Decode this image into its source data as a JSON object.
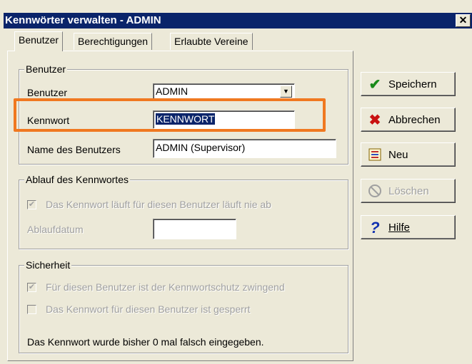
{
  "window": {
    "title": "Kennwörter verwalten - ADMIN",
    "close_label": "x"
  },
  "tabs": [
    {
      "label": "Benutzer"
    },
    {
      "label": "Berechtigungen"
    },
    {
      "label": "Erlaubte Vereine"
    }
  ],
  "group_user": {
    "title": "Benutzer",
    "user_label": "Benutzer",
    "user_value": "ADMIN",
    "password_label": "Kennwort",
    "password_value": "KENNWORT",
    "name_label": "Name des Benutzers",
    "name_value": "ADMIN (Supervisor)"
  },
  "group_expiry": {
    "title": "Ablauf des Kennwortes",
    "never_expires_label": "Das Kennwort läuft für diesen Benutzer läuft nie ab",
    "never_expires_checked": true,
    "expiry_date_label": "Ablaufdatum",
    "expiry_date_value": ""
  },
  "group_security": {
    "title": "Sicherheit",
    "mandatory_label": "Für diesen Benutzer ist der Kennwortschutz zwingend",
    "mandatory_checked": true,
    "locked_label": "Das Kennwort für diesen Benutzer ist gesperrt",
    "locked_checked": false,
    "wrong_attempts_text": "Das Kennwort wurde bisher 0 mal falsch eingegeben."
  },
  "buttons": {
    "save": "Speichern",
    "cancel": "Abbrechen",
    "new": "Neu",
    "delete": "Löschen",
    "help": "Hilfe"
  },
  "colors": {
    "title_bar": "#0a246a",
    "highlight": "#f07820",
    "selection": "#0a246a"
  },
  "icons": {
    "save": "checkmark-icon",
    "cancel": "x-icon",
    "new": "new-document-icon",
    "delete": "prohibited-icon",
    "help": "question-mark-icon"
  }
}
